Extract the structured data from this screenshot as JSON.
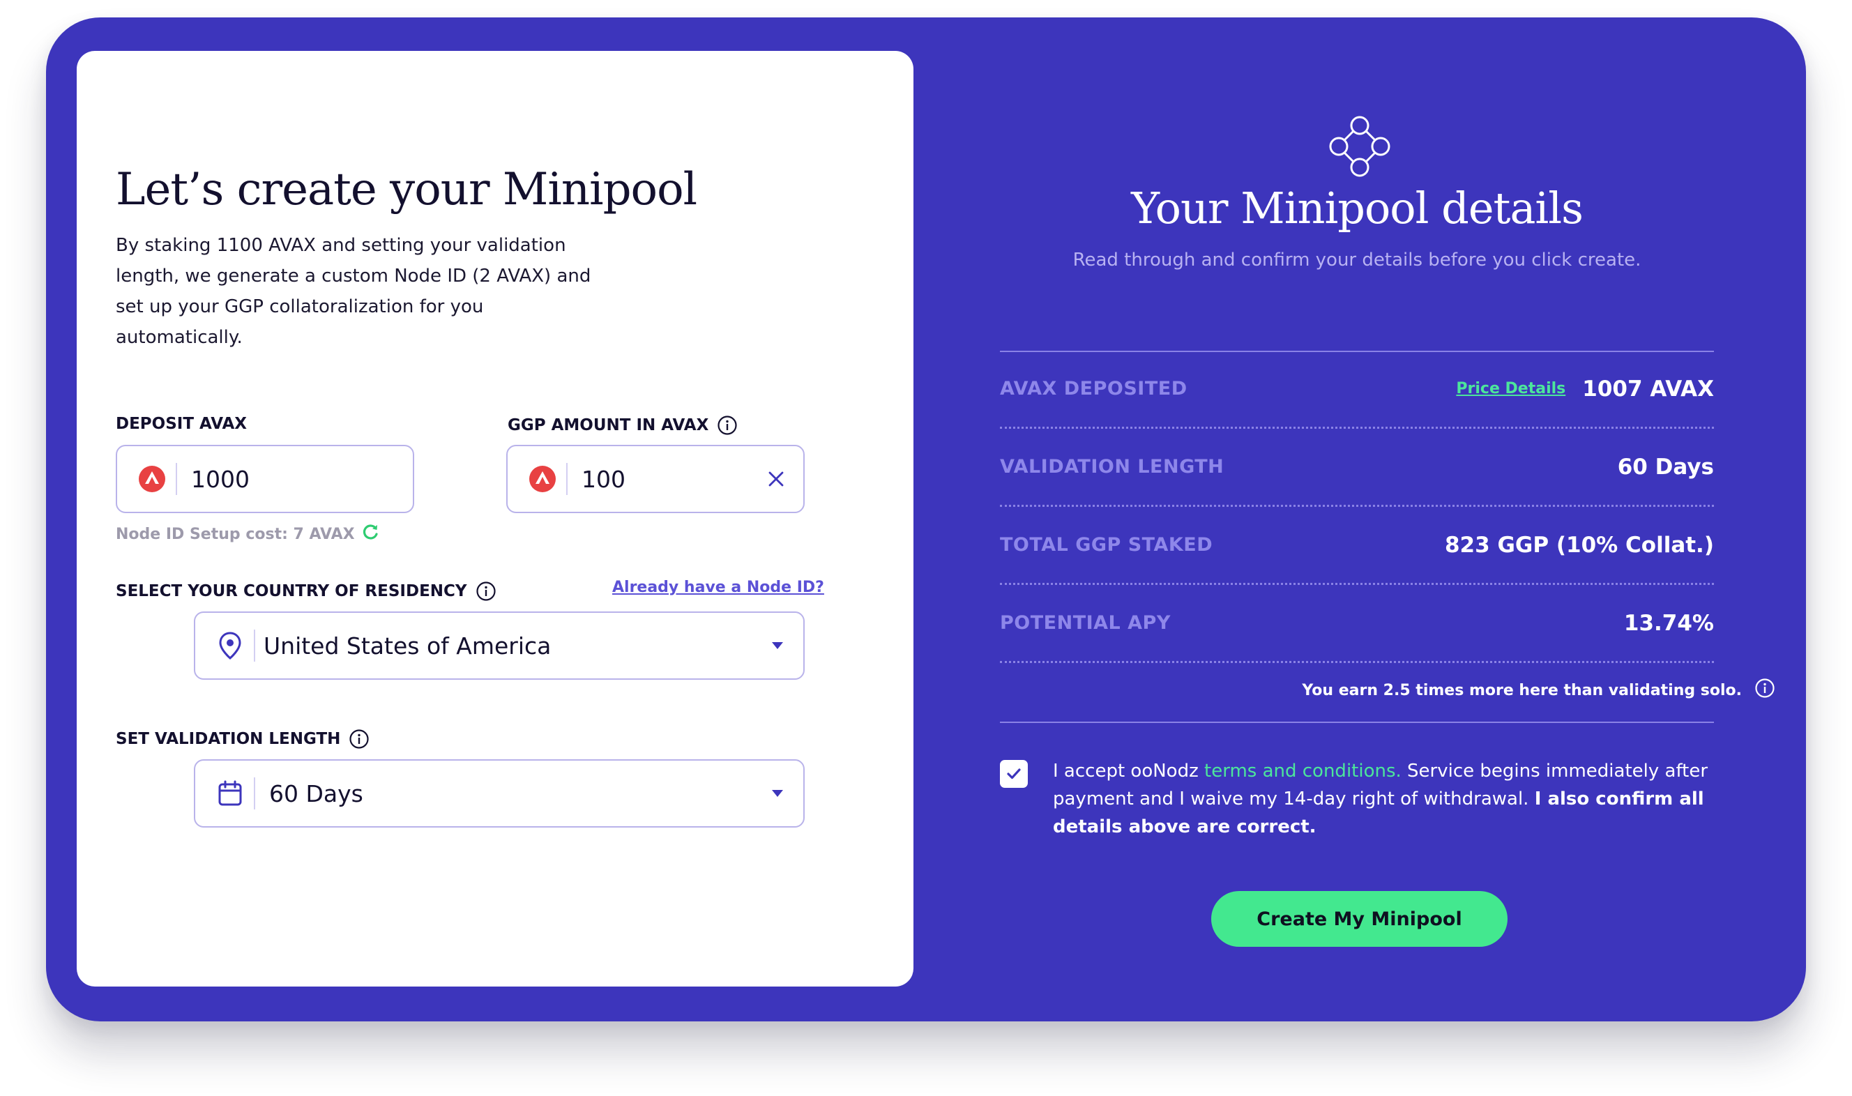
{
  "colors": {
    "frame_bg": "#3d35bc",
    "accent_green": "#43e88f",
    "link_green": "#4ce69b",
    "muted_label": "#8e87ea",
    "input_border": "#b9b3ea",
    "avax_red": "#e84142"
  },
  "left": {
    "title": "Let’s create your Minipool",
    "intro": "By staking 1100 AVAX and setting your validation length, we generate a custom Node ID (2 AVAX) and set up your GGP collatoralization for you automatically.",
    "deposit": {
      "label": "DEPOSIT AVAX",
      "value": "1000",
      "icon": "avax-icon"
    },
    "ggp": {
      "label": "GGP AMOUNT IN AVAX",
      "value": "100",
      "icon": "avax-icon",
      "clear_icon": "close-icon"
    },
    "hint": "Node ID Setup cost: 7 AVAX",
    "country": {
      "label": "SELECT YOUR COUNTRY OF RESIDENCY",
      "link": "Already have a Node ID?",
      "value": "United States of America",
      "icon": "location-pin-icon"
    },
    "validation": {
      "label": "SET VALIDATION LENGTH",
      "value": "60 Days",
      "icon": "calendar-icon"
    }
  },
  "right": {
    "icon": "minipool-nodes-icon",
    "title": "Your Minipool details",
    "subtitle": "Read through and confirm your details before you click create.",
    "rows": [
      {
        "label": "AVAX DEPOSITED",
        "link": "Price Details",
        "value": "1007 AVAX"
      },
      {
        "label": "VALIDATION LENGTH",
        "value": "60 Days"
      },
      {
        "label": "TOTAL GGP STAKED",
        "value": "823 GGP (10% Collat.)"
      },
      {
        "label": "POTENTIAL APY",
        "value": "13.74%"
      }
    ],
    "earn_note": "You earn 2.5 times more here than validating solo.",
    "checkbox_checked": true,
    "terms": {
      "pre": "I accept ooNodz ",
      "link": "terms and conditions.",
      "mid": " Service begins immediately after payment and I waive my 14-day right of withdrawal. ",
      "bold": "I also confirm all details above are correct."
    },
    "create_button": "Create My Minipool"
  }
}
